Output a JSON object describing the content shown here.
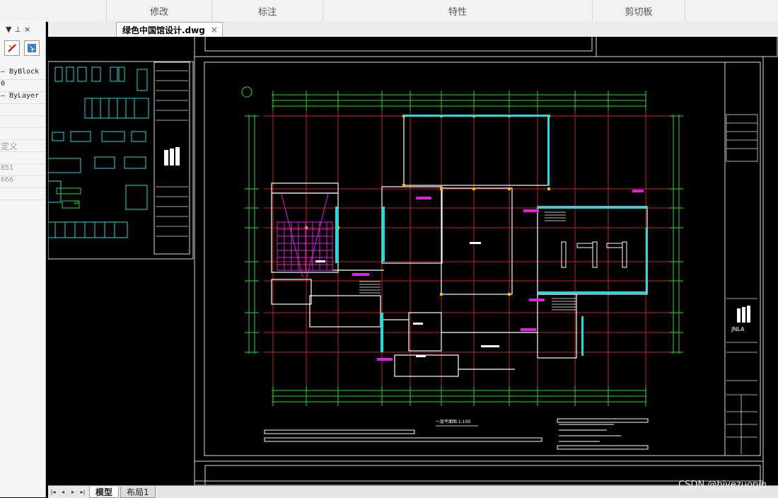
{
  "ribbon": {
    "panels": [
      "修改",
      "标注",
      "特性",
      "剪切板"
    ]
  },
  "left_panel": {
    "header_arrow": "▼",
    "header_pin": "⊥",
    "header_close": "×",
    "rows": [
      "— ByBlock",
      "0",
      "— ByLayer",
      "",
      "",
      "",
      "定义",
      "",
      "851",
      "666",
      "",
      ""
    ]
  },
  "document_tab": {
    "title": "绿色中国馆设计.dwg",
    "close": "×"
  },
  "drawing": {
    "plan_title": "一层平面图  1:100",
    "logo_text": "JNLA"
  },
  "bottom_bar": {
    "nav": [
      "|◂",
      "◂",
      "▸",
      "▸|"
    ],
    "tabs": [
      "模型",
      "布局1"
    ]
  },
  "watermark": "CSDN @biyezuopin",
  "colors": {
    "background": "#000000",
    "wall": "#ffffff",
    "grid": "#cc2222",
    "green": "#22dd22",
    "cyan": "#22dddd",
    "magenta": "#dd22dd",
    "yellow": "#e6c200"
  }
}
